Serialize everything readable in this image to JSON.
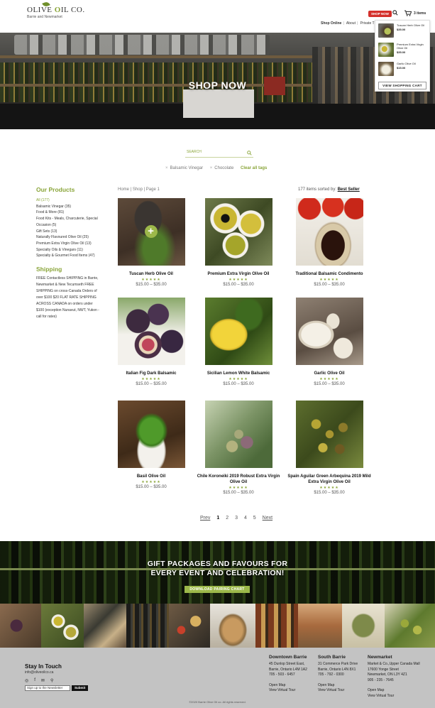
{
  "header": {
    "logo_brand_a": "OLIVE ",
    "logo_brand_o": "O",
    "logo_brand_b": "IL CO.",
    "logo_sub": "Barrie and Newmarket",
    "shop_now_badge": "SHOP NOW",
    "cart_count": "3 items",
    "nav": [
      "Shop Online",
      "About",
      "Private T"
    ]
  },
  "minicart": {
    "items": [
      {
        "name": "Tuscan Herb Olive Oil",
        "price": "$35.00"
      },
      {
        "name": "Premium Extra Virgin Olive Oil",
        "price": "$35.00"
      },
      {
        "name": "Garlic Olive Oil",
        "price": "$15.00"
      }
    ],
    "button": "VIEW SHOPPING CART"
  },
  "hero": {
    "title": "SHOP NOW"
  },
  "search": {
    "placeholder": "SEARCH"
  },
  "tags": {
    "active": [
      "Balsamic Vinegar",
      "Chocolate"
    ],
    "clear": "Clear all tags"
  },
  "sidebar": {
    "products_heading": "Our Products",
    "categories": [
      "All (177)",
      "Balsamic Vinegar (35)",
      "Food & More (81)",
      "Food Kits - Meals, Charcuterie, Special",
      "Occasion (5)",
      "Gift Sets (13)",
      "Naturally Flavoured Olive Oil (25)",
      "Premium Extra Virgin Olive Oil (13)",
      "Specialty Oils & Vinegars (11)",
      "Specialty & Gourmet Food Items (47)"
    ],
    "shipping_heading": "Shipping",
    "shipping_lines": [
      "FREE Contactless SHIPPING in Barrie,",
      "Newmarket & New Tecumseth FREE",
      "SHIPPING on cross-Canada Orders of",
      "over $100 $20 FLAT RATE SHIPPING",
      "ACROSS CANADA on orders under",
      "$100 (exception Nunavut, NWT, Yukon -",
      "call for rates)"
    ]
  },
  "listing": {
    "breadcrumb": "Home  |  Shop  |  Page 1",
    "sorted_prefix": "177 items sorted by: ",
    "sorted_by": "Best Seller",
    "stars": "★★★★★",
    "products": [
      {
        "name": "Tuscan Herb Olive Oil",
        "price": "$15.00 – $35.00"
      },
      {
        "name": "Premium Extra Virgin Olive Oil",
        "price": "$15.00 – $35.00"
      },
      {
        "name": "Traditional Balsamic Condimento",
        "price": "$15.00 – $35.00"
      },
      {
        "name": "Italian Fig Dark Balsamic",
        "price": "$15.00 – $35.00"
      },
      {
        "name": "Sicilian Lemon White Balsamic",
        "price": "$15.00 – $35.00"
      },
      {
        "name": "Garlic Olive Oil",
        "price": "$15.00 – $35.00"
      },
      {
        "name": "Basil Olive Oil",
        "price": "$15.00 – $35.00"
      },
      {
        "name": "Chile Koroneiki 2019 Robust Extra Virgin Olive Oil",
        "price": "$15.00 – $35.00"
      },
      {
        "name": "Spain Aguilar Green Arbequina 2019 Mild Extra Virgin Olive Oil",
        "price": "$15.00 – $35.00"
      }
    ]
  },
  "pagination": {
    "prev": "Prev",
    "pages": [
      "1",
      "2",
      "3",
      "4",
      "5"
    ],
    "next": "Next"
  },
  "gift": {
    "title_line1": "GIFT PACKAGES AND FAVOURS FOR",
    "title_line2": "EVERY EVENT AND CELEBRATION!",
    "button": "DOWNLOAD PAIRING CHART"
  },
  "footer": {
    "stay_heading": "Stay In Touch",
    "email": "info@oliveoilco.ca",
    "newsletter_placeholder": "Sign up to the Newsletter",
    "submit": "Submit",
    "locations": [
      {
        "title": "Downtown Barrie",
        "lines": [
          "45 Dunlop Street East,",
          "Barrie, Ontario L4M 1A2",
          "705 - 503 - 6457"
        ],
        "map": "Open Map",
        "tour": "View Virtual Tour"
      },
      {
        "title": "South Barrie",
        "lines": [
          "31 Commerce Park Drive",
          "Barrie, Ontario L4N 8X1",
          "705 - 792 - 0300"
        ],
        "map": "Open Map",
        "tour": "View Virtual Tour"
      },
      {
        "title": "Newmarket",
        "lines": [
          "Market & Co.,Upper Canada Mall",
          "17600 Yonge Street",
          "Newmarket, ON L3Y 4Z1",
          "905 - 235 - 7645"
        ],
        "map": "Open Map",
        "tour": "View Virtual Tour"
      }
    ],
    "copyright": "©2020 Barrie Olive Oil co. All rights reserved."
  },
  "colors": {
    "accent": "#8aa53a",
    "badge": "#d4302b"
  }
}
